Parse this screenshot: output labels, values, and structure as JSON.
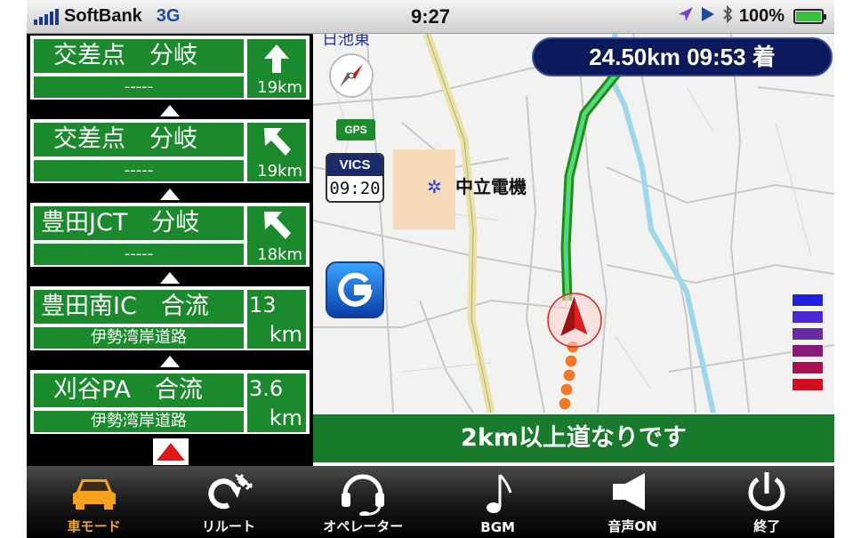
{
  "status_bar": {
    "carrier": "SoftBank",
    "network": "3G",
    "time": "9:27",
    "battery": "100%",
    "icons": [
      "location-icon",
      "play-icon",
      "bluetooth-icon",
      "battery-icon"
    ]
  },
  "guidance": {
    "signs": [
      {
        "main": "交差点　分岐",
        "sub": "-----",
        "direction": "straight",
        "distance": "19km"
      },
      {
        "main": "交差点　分岐",
        "sub": "-----",
        "direction": "left",
        "distance": "19km"
      },
      {
        "main": "豊田JCT　分岐",
        "sub": "-----",
        "direction": "left",
        "distance": "18km"
      },
      {
        "main": "豊田南IC　合流",
        "sub": "伊勢湾岸道路",
        "distance_value": "13",
        "distance_unit": "km"
      },
      {
        "main": "刈谷PA　合流",
        "sub": "伊勢湾岸道路",
        "distance_value": "3.6",
        "distance_unit": "km"
      }
    ]
  },
  "map": {
    "eta": "24.50km 09:53 着",
    "top_label": "日池東",
    "poi": "中立電機",
    "gps_label": "GPS",
    "vics_label": "VICS",
    "vics_time": "09:20",
    "message": "2km以上道なりです",
    "traffic_colors": [
      "#2020e0",
      "#4a2ad0",
      "#6a2aa8",
      "#8a1a7a",
      "#aa1050",
      "#d01020"
    ]
  },
  "toolbar": {
    "items": [
      {
        "label": "車モード",
        "icon": "car-icon",
        "active": true
      },
      {
        "label": "リルート",
        "icon": "reroute-icon"
      },
      {
        "label": "オペレーター",
        "icon": "operator-headset-icon"
      },
      {
        "label": "BGM",
        "icon": "music-note-icon"
      },
      {
        "label": "音声ON",
        "icon": "speaker-icon"
      },
      {
        "label": "終了",
        "icon": "power-icon"
      }
    ],
    "accent": "#f6a21e"
  }
}
